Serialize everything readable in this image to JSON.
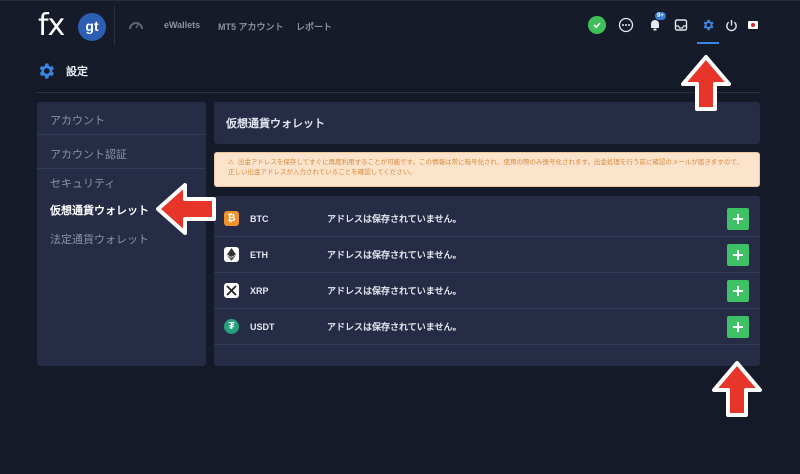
{
  "logo": {
    "fx": "fx",
    "gt": "gt"
  },
  "nav": {
    "ewallets": "eWallets",
    "mt5": "MT5 アカウント",
    "report": "レポート",
    "inbox_badge": "9+"
  },
  "page": {
    "title": "設定"
  },
  "sidebar": {
    "items": [
      {
        "label": "アカウント"
      },
      {
        "label": "アカウント認証"
      },
      {
        "label": "セキュリティ"
      },
      {
        "label": "仮想通貨ウォレット"
      },
      {
        "label": "法定通貨ウォレット"
      }
    ]
  },
  "main": {
    "header": "仮想通貨ウォレット",
    "alert": "出金アドレスを保存してすぐに再度利用することが可能です。この情報は常に暗号化され、使用の際のみ復号化されます。出金処理を行う前に確認のメールが届きますので、正しい出金アドレスが入力されていることを確認してください。",
    "wallets": [
      {
        "coin": "BTC",
        "status": "アドレスは保存されていません。"
      },
      {
        "coin": "ETH",
        "status": "アドレスは保存されていません。"
      },
      {
        "coin": "XRP",
        "status": "アドレスは保存されていません。"
      },
      {
        "coin": "USDT",
        "status": "アドレスは保存されていません。"
      }
    ]
  },
  "colors": {
    "accent": "#3a86e6",
    "add_button": "#3ec165",
    "annotation_arrow": "#e8352a",
    "alert_bg": "#fbe3cc"
  },
  "icons": [
    "gauge-icon",
    "check-icon",
    "chat-icon",
    "bell-icon",
    "inbox-icon",
    "gear-icon",
    "power-icon",
    "japan-flag-icon",
    "plus-icon"
  ]
}
